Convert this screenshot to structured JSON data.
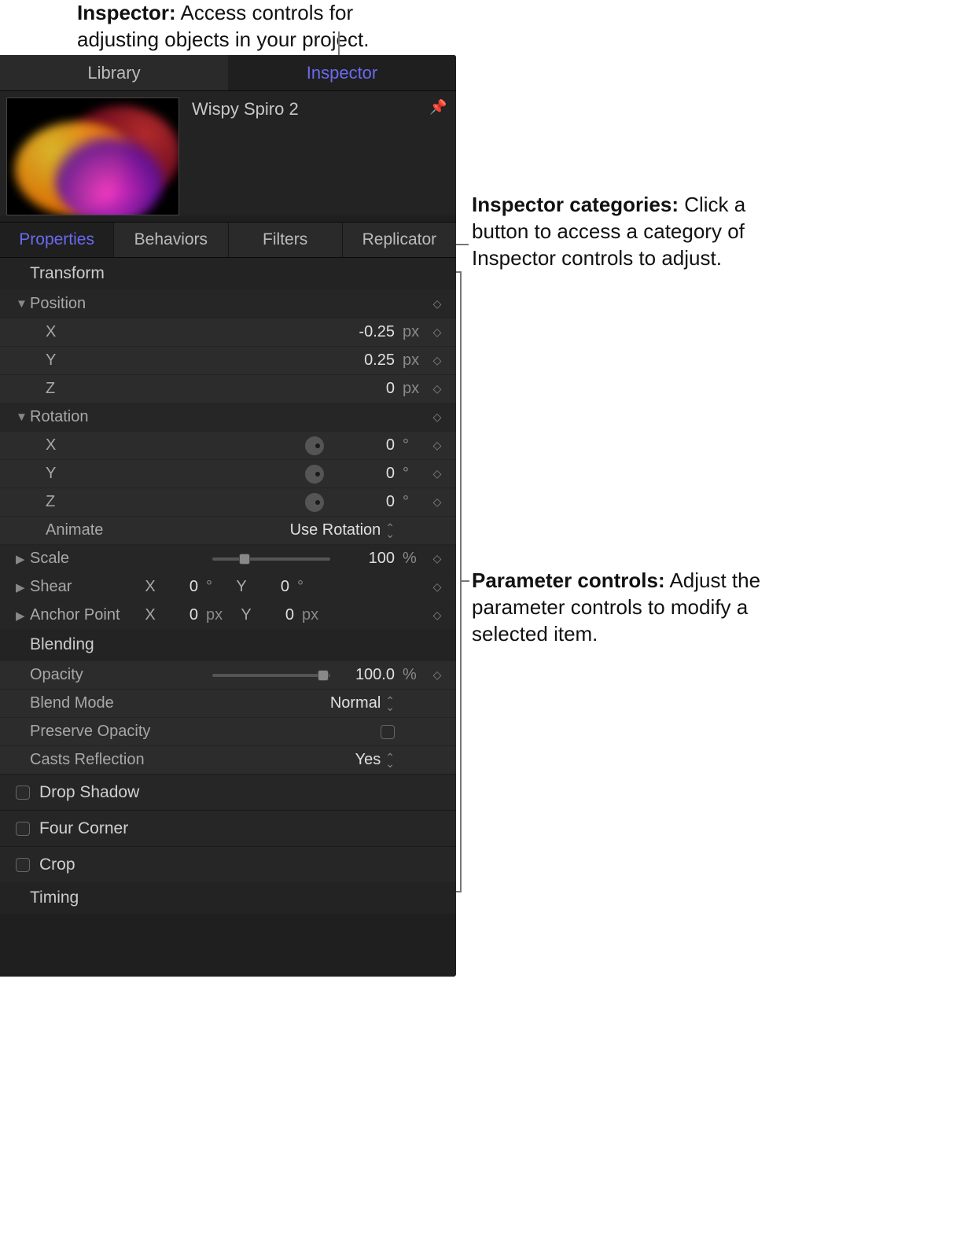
{
  "annotations": {
    "top_b": "Inspector:",
    "top_rest": " Access controls for adjusting objects in your project.",
    "cats_b": "Inspector categories:",
    "cats_rest": " Click a button to access a category of Inspector controls to adjust.",
    "params_b": "Parameter controls:",
    "params_rest": " Adjust the parameter controls to modify a selected item."
  },
  "topTabs": {
    "library": "Library",
    "inspector": "Inspector"
  },
  "item": {
    "title": "Wispy Spiro 2"
  },
  "catTabs": {
    "properties": "Properties",
    "behaviors": "Behaviors",
    "filters": "Filters",
    "replicator": "Replicator"
  },
  "sections": {
    "transform": "Transform",
    "blending": "Blending",
    "timing": "Timing"
  },
  "transform": {
    "position": {
      "label": "Position",
      "x_label": "X",
      "y_label": "Y",
      "z_label": "Z",
      "x": "-0.25",
      "y": "0.25",
      "z": "0",
      "unit": "px"
    },
    "rotation": {
      "label": "Rotation",
      "x_label": "X",
      "y_label": "Y",
      "z_label": "Z",
      "x": "0",
      "y": "0",
      "z": "0",
      "unit": "°",
      "animate_label": "Animate",
      "animate_value": "Use Rotation"
    },
    "scale": {
      "label": "Scale",
      "value": "100",
      "unit": "%"
    },
    "shear": {
      "label": "Shear",
      "x_label": "X",
      "x": "0",
      "y_label": "Y",
      "y": "0",
      "unit": "°"
    },
    "anchor": {
      "label": "Anchor Point",
      "x_label": "X",
      "x": "0",
      "y_label": "Y",
      "y": "0",
      "unit": "px"
    }
  },
  "blending": {
    "opacity": {
      "label": "Opacity",
      "value": "100.0",
      "unit": "%"
    },
    "blendmode": {
      "label": "Blend Mode",
      "value": "Normal"
    },
    "preserve": {
      "label": "Preserve Opacity"
    },
    "casts": {
      "label": "Casts Reflection",
      "value": "Yes"
    }
  },
  "groups": {
    "dropShadow": "Drop Shadow",
    "fourCorner": "Four Corner",
    "crop": "Crop"
  }
}
